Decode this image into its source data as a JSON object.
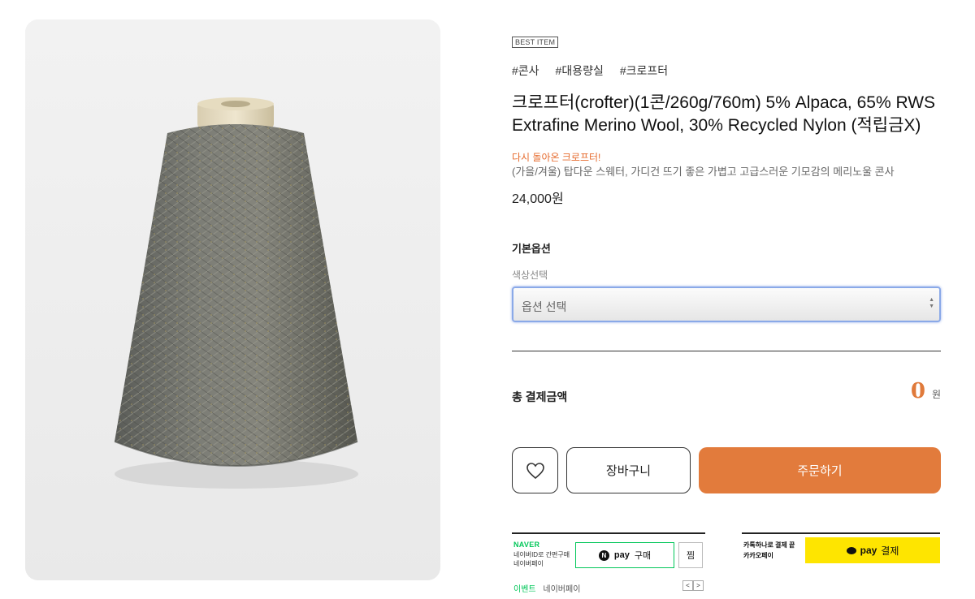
{
  "product": {
    "badge": "BEST ITEM",
    "tags": [
      "#콘사",
      "#대용량실",
      "#크로프터"
    ],
    "title": "크로프터(crofter)(1콘/260g/760m) 5% Alpaca, 65% RWS Extrafine Merino Wool, 30% Recycled Nylon (적립금X)",
    "promo": "다시 돌아온 크로프터!",
    "description": "(가을/겨울) 탑다운 스웨터, 가디건 뜨기 좋은 가볍고 고급스러운 기모감의 메리노울 콘사",
    "price": "24,000원"
  },
  "options": {
    "section_title": "기본옵션",
    "label": "색상선택",
    "select_value": "옵션 선택"
  },
  "total": {
    "label": "총 결제금액",
    "value": "0",
    "unit": "원"
  },
  "actions": {
    "wish_icon": "heart-icon",
    "cart_label": "장바구니",
    "order_label": "주문하기",
    "order_color": "#e27b3c"
  },
  "naverpay": {
    "brand": "NAVER",
    "subtitle_line1": "네이버ID로 간편구매",
    "subtitle_line2": "네이버페이",
    "circle_letter": "N",
    "button_pay": "pay",
    "button_buy": "구매",
    "zzim_label": "찜",
    "event_label": "이벤트",
    "npay_label": "네이버페이",
    "prev_arrow": "<",
    "next_arrow": ">",
    "brand_color": "#03c75a"
  },
  "kakaopay": {
    "line1": "카톡하나로 결제 끝",
    "line2": "카카오페이",
    "button_pay": "pay",
    "button_label": "결제",
    "brand_color": "#fee500"
  }
}
